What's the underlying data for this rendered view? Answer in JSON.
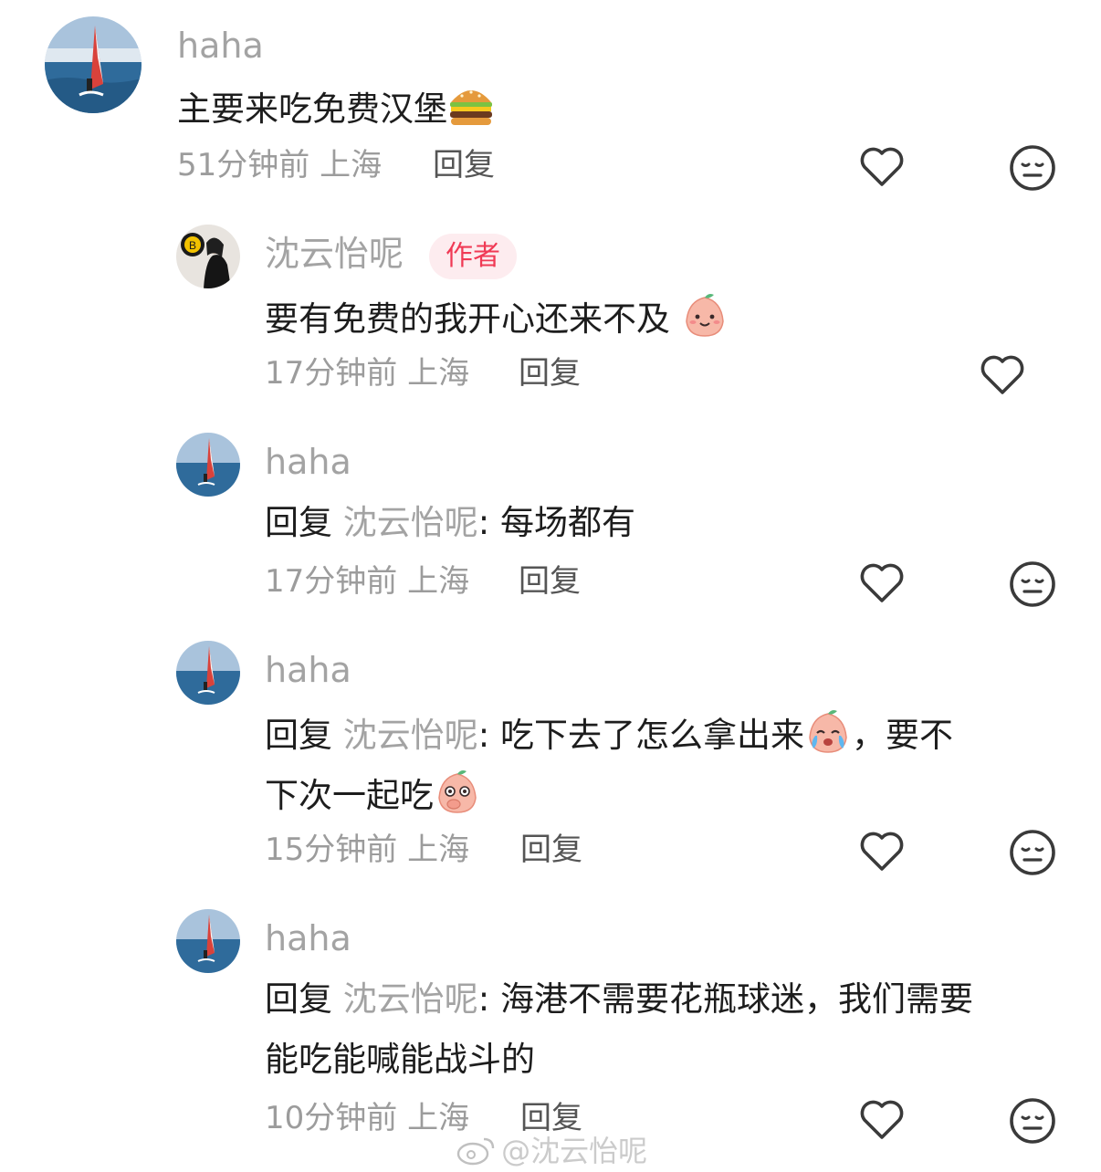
{
  "comments": [
    {
      "user": "haha",
      "text": "主要来吃免费汉堡",
      "emoji": "burger",
      "time": "51分钟前",
      "location": "上海",
      "reply_label": "回复"
    },
    {
      "user": "沈云怡呢",
      "badge": "作者",
      "text": "要有免费的我开心还来不及",
      "emoji": "smiling-peach",
      "time": "17分钟前",
      "location": "上海",
      "reply_label": "回复"
    },
    {
      "user": "haha",
      "reply_prefix": "回复",
      "reply_to": "沈云怡呢",
      "colon": ":",
      "text": "每场都有",
      "time": "17分钟前",
      "location": "上海",
      "reply_label": "回复"
    },
    {
      "user": "haha",
      "reply_prefix": "回复",
      "reply_to": "沈云怡呢",
      "colon": ":",
      "text_part1": "吃下去了怎么拿出来",
      "text_part2": "，要不",
      "text_line2": "下次一起吃",
      "emojis": [
        "crying-peach",
        "shocked-peach"
      ],
      "time": "15分钟前",
      "location": "上海",
      "reply_label": "回复"
    },
    {
      "user": "haha",
      "reply_prefix": "回复",
      "reply_to": "沈云怡呢",
      "colon": ":",
      "text_line1": "海港不需要花瓶球迷，我们需要",
      "text_line2": "能吃能喊能战斗的",
      "time": "10分钟前",
      "location": "上海",
      "reply_label": "回复"
    }
  ],
  "watermark": "@沈云怡呢",
  "icons": [
    "heart-icon",
    "meh-face-icon"
  ],
  "colors": {
    "badge": "#f03a55",
    "badge_bg": "#fdecef",
    "muted": "#a3a3a3"
  }
}
